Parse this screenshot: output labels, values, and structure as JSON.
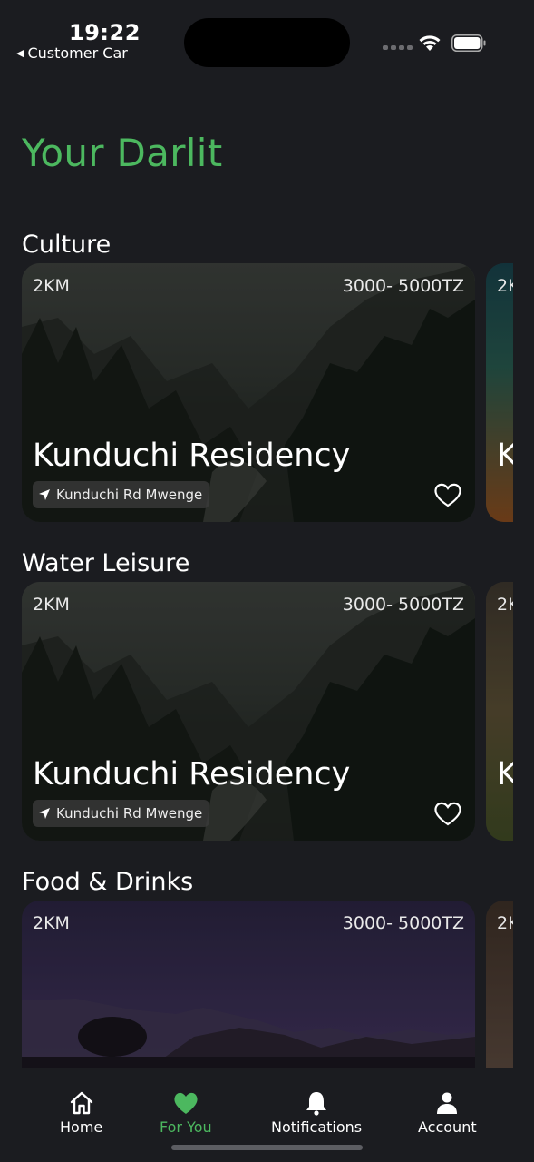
{
  "status_bar": {
    "time": "19:22",
    "back_label": "Customer Car",
    "back_icon": "triangle-left-icon"
  },
  "page_title": "Your Darlit",
  "sections": [
    {
      "title": "Culture",
      "cards": [
        {
          "distance": "2KM",
          "price": "3000- 5000TZ",
          "name": "Kunduchi Residency",
          "location": "Kunduchi Rd Mwenge"
        }
      ],
      "peek": {
        "distance": "2K",
        "name": "K"
      }
    },
    {
      "title": "Water Leisure",
      "cards": [
        {
          "distance": "2KM",
          "price": "3000- 5000TZ",
          "name": "Kunduchi Residency",
          "location": "Kunduchi Rd Mwenge"
        }
      ],
      "peek": {
        "distance": "2K",
        "name": "K"
      }
    },
    {
      "title": "Food & Drinks",
      "cards": [
        {
          "distance": "2KM",
          "price": "3000- 5000TZ"
        }
      ],
      "peek": {
        "distance": "2K"
      }
    }
  ],
  "tab_bar": {
    "tabs": [
      {
        "label": "Home",
        "icon": "house-icon",
        "active": false
      },
      {
        "label": "For You",
        "icon": "heart-icon",
        "active": true
      },
      {
        "label": "Notifications",
        "icon": "bell-icon",
        "active": false
      },
      {
        "label": "Account",
        "icon": "person-icon",
        "active": false
      }
    ]
  },
  "colors": {
    "accent": "#4cb85f",
    "background": "#1b1c20"
  }
}
